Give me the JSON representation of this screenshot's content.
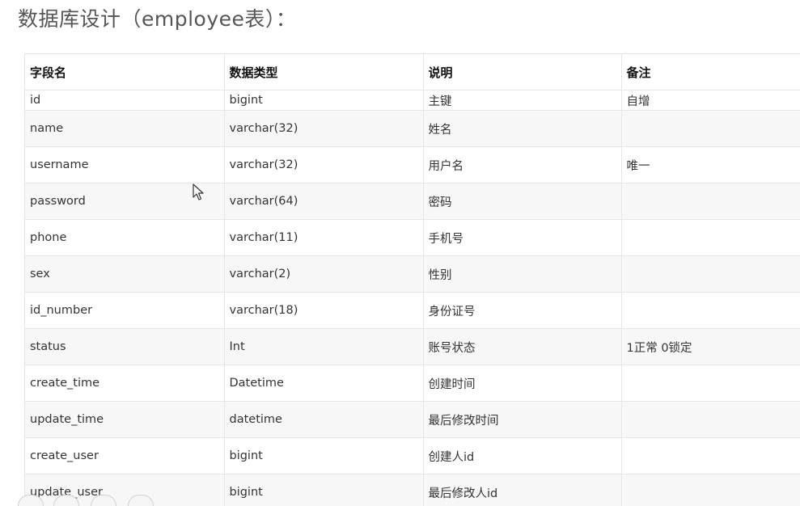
{
  "title": "数据库设计（employee表）：",
  "table": {
    "headers": [
      "字段名",
      "数据类型",
      "说明",
      "备注"
    ],
    "rows": [
      {
        "field": "id",
        "type": "bigint",
        "desc": "主键",
        "note": "自增"
      },
      {
        "field": "name",
        "type": "varchar(32)",
        "desc": "姓名",
        "note": ""
      },
      {
        "field": "username",
        "type": "varchar(32)",
        "desc": "用户名",
        "note": "唯一"
      },
      {
        "field": "password",
        "type": "varchar(64)",
        "desc": "密码",
        "note": ""
      },
      {
        "field": "phone",
        "type": "varchar(11)",
        "desc": "手机号",
        "note": ""
      },
      {
        "field": "sex",
        "type": "varchar(2)",
        "desc": "性别",
        "note": ""
      },
      {
        "field": "id_number",
        "type": "varchar(18)",
        "desc": "身份证号",
        "note": ""
      },
      {
        "field": "status",
        "type": "Int",
        "desc": "账号状态",
        "note": "1正常 0锁定"
      },
      {
        "field": "create_time",
        "type": "Datetime",
        "desc": "创建时间",
        "note": ""
      },
      {
        "field": "update_time",
        "type": "datetime",
        "desc": "最后修改时间",
        "note": ""
      },
      {
        "field": "create_user",
        "type": "bigint",
        "desc": "创建人id",
        "note": ""
      },
      {
        "field": "update_user",
        "type": "bigint",
        "desc": "最后修改人id",
        "note": ""
      }
    ]
  },
  "icons": {
    "cursor": "mouse-pointer-icon"
  }
}
